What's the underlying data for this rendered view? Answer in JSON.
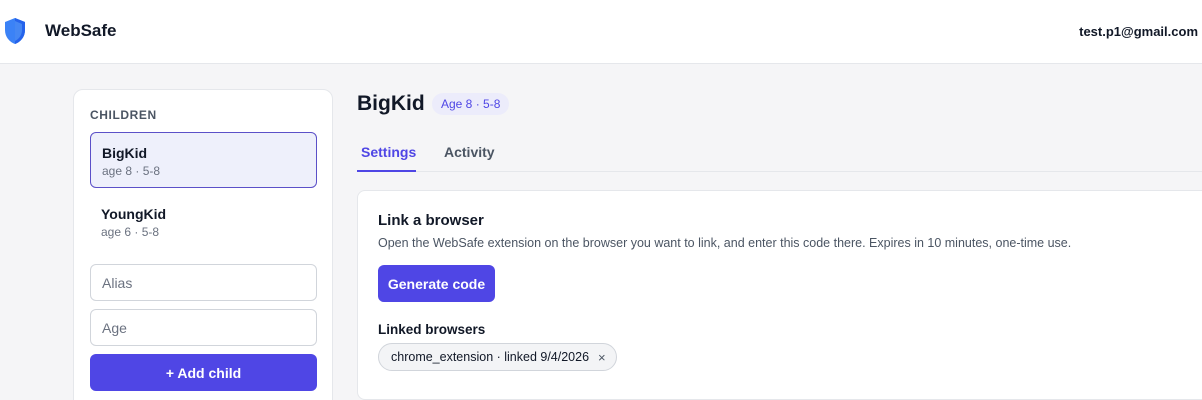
{
  "app": {
    "name": "WebSafe",
    "logo_icon": "shield-icon"
  },
  "user": {
    "email": "test.p1@gmail.com"
  },
  "sidebar": {
    "title": "CHILDREN",
    "children": [
      {
        "name": "BigKid",
        "meta": "age 8 · 5-8",
        "active": true
      },
      {
        "name": "YoungKid",
        "meta": "age 6 · 5-8",
        "active": false
      }
    ],
    "alias_placeholder": "Alias",
    "age_placeholder": "Age",
    "add_button_label": "+ Add child"
  },
  "main": {
    "child_name": "BigKid",
    "age_badge": "Age 8 · 5-8",
    "tabs": [
      {
        "label": "Settings",
        "active": true
      },
      {
        "label": "Activity",
        "active": false
      }
    ],
    "link_card": {
      "title": "Link a browser",
      "description": "Open the WebSafe extension on the browser you want to link, and enter this code there. Expires in 10 minutes, one-time use.",
      "generate_button_label": "Generate code",
      "linked_title": "Linked browsers",
      "linked_browsers": [
        {
          "label": "chrome_extension · linked 9/4/2026",
          "remove_glyph": "×"
        }
      ]
    }
  },
  "colors": {
    "accent": "#4f46e5",
    "active_item_bg": "#eef0fb",
    "page_bg": "#f5f5f7"
  }
}
